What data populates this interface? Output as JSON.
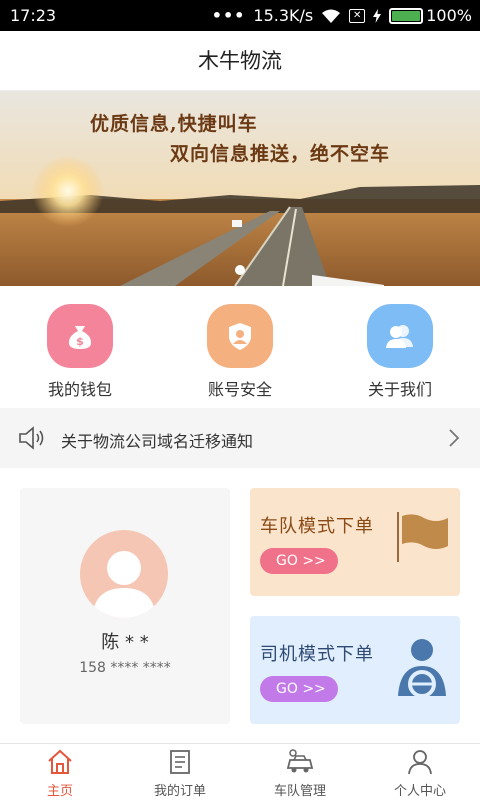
{
  "status_bar": {
    "time": "17:23",
    "dots": "•••",
    "net_speed": "15.3K/s",
    "battery": "100%",
    "battery_level": 1.0
  },
  "header": {
    "title": "木牛物流"
  },
  "banner": {
    "line1": "优质信息,快捷叫车",
    "line2": "双向信息推送，绝不空车"
  },
  "actions": [
    {
      "label": "我的钱包",
      "icon": "money-bag-icon",
      "color": "#f3849a"
    },
    {
      "label": "账号安全",
      "icon": "shield-icon",
      "color": "#f5b07f"
    },
    {
      "label": "关于我们",
      "icon": "users-icon",
      "color": "#7dbcf5"
    }
  ],
  "notice": {
    "text": "关于物流公司域名迁移通知"
  },
  "profile": {
    "name": "陈 * *",
    "phone": "158 **** ****"
  },
  "cards": {
    "team": {
      "title": "车队模式下单",
      "go": "GO >>"
    },
    "driver": {
      "title": "司机模式下单",
      "go": "GO >>"
    }
  },
  "nav": [
    {
      "label": "主页",
      "icon": "home-icon",
      "active": true
    },
    {
      "label": "我的订单",
      "icon": "order-list-icon",
      "active": false
    },
    {
      "label": "车队管理",
      "icon": "fleet-icon",
      "active": false
    },
    {
      "label": "个人中心",
      "icon": "person-icon",
      "active": false
    }
  ],
  "colors": {
    "accent": "#e4573c",
    "nav_inactive": "#555555"
  }
}
